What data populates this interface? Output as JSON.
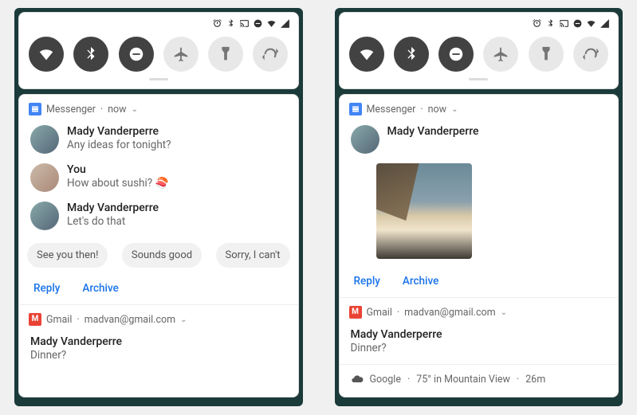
{
  "left": {
    "qs": {
      "app": "Messenger",
      "time": "now"
    },
    "messages": [
      {
        "name": "Mady Vanderperre",
        "text": "Any ideas for tonight?"
      },
      {
        "name": "You",
        "text": "How about sushi? 🍣"
      },
      {
        "name": "Mady Vanderperre",
        "text": "Let's do that"
      }
    ],
    "chips": [
      "See you then!",
      "Sounds good",
      "Sorry, I can't"
    ],
    "actions": {
      "reply": "Reply",
      "archive": "Archive"
    },
    "gmail": {
      "app": "Gmail",
      "account": "madvan@gmail.com",
      "sender": "Mady Vanderperre",
      "subject": "Dinner?"
    }
  },
  "right": {
    "qs": {
      "app": "Messenger",
      "time": "now"
    },
    "sender": "Mady Vanderperre",
    "actions": {
      "reply": "Reply",
      "archive": "Archive"
    },
    "gmail": {
      "app": "Gmail",
      "account": "madvan@gmail.com",
      "sender": "Mady Vanderperre",
      "subject": "Dinner?"
    },
    "weather": {
      "provider": "Google",
      "summary": "75° in Mountain View",
      "age": "26m"
    }
  }
}
